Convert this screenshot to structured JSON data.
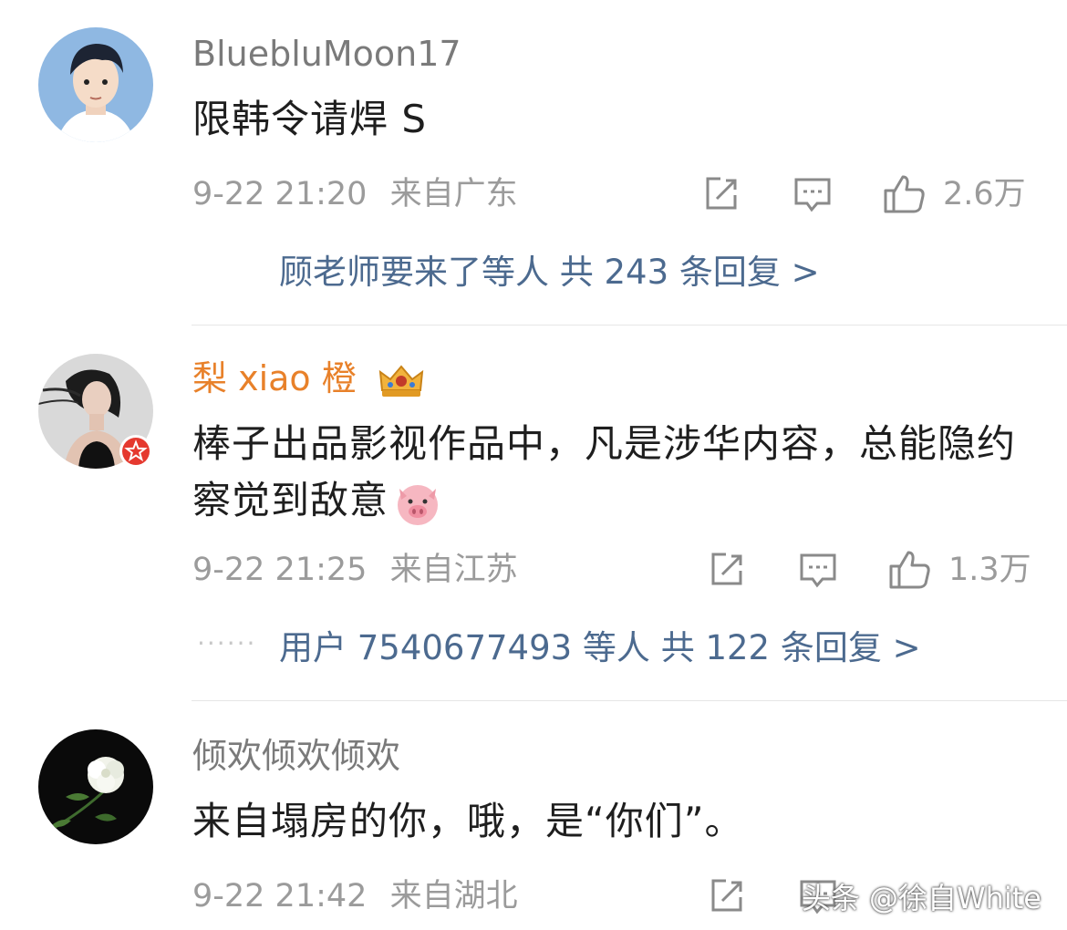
{
  "comments": [
    {
      "username": "BluebluMoon17",
      "text": "限韩令请焊 S",
      "date": "9-22 21:20",
      "location": "来自广东",
      "likes": "2.6万",
      "reply_summary": "顾老师要来了等人  共 243 条回复 >",
      "vip": false
    },
    {
      "username": "梨 xiao 橙",
      "text": "棒子出品影视作品中，凡是涉华内容，总能隐约察觉到敌意",
      "emoji": "pig-face",
      "date": "9-22 21:25",
      "location": "来自江苏",
      "likes": "1.3万",
      "reply_summary": "用户 7540677493 等人  共 122 条回复 >",
      "vip": true
    },
    {
      "username": "倾欢倾欢倾欢",
      "text": "来自塌房的你，哦，是“你们”。",
      "date": "9-22 21:42",
      "location": "来自湖北",
      "likes": "",
      "vip": false
    }
  ],
  "icons": {
    "share": "share-icon",
    "comment": "comment-icon",
    "like": "thumbs-up-icon",
    "crown": "crown-icon",
    "badge": "star-badge-icon"
  },
  "colors": {
    "vip_name": "#e8812a",
    "reply_link": "#4c6a8f",
    "meta": "#9b9b9b",
    "text": "#1e1e1e"
  },
  "watermark": "头条 @徐自White"
}
